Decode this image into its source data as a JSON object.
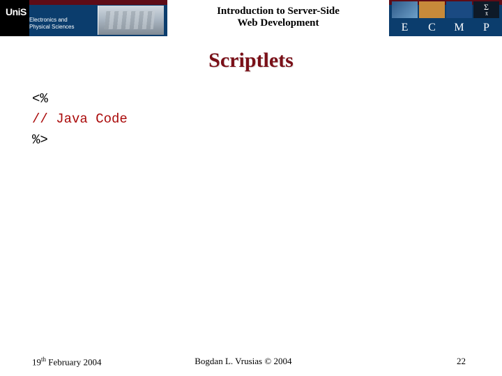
{
  "header": {
    "uni_logo_text": "UniS",
    "dept_line1": "Electronics and",
    "dept_line2": "Physical Sciences",
    "title_line1": "Introduction to Server-Side",
    "title_line2": "Web Development",
    "letters": [
      "E",
      "C",
      "M",
      "P"
    ],
    "sigma": "Σ",
    "sigma_sub": "x̄"
  },
  "slide": {
    "title": "Scriptlets",
    "code": {
      "open": "<%",
      "comment": "// Java Code",
      "close": "%>"
    }
  },
  "footer": {
    "date_day": "19",
    "date_suffix": "th",
    "date_rest": " February 2004",
    "author": "Bogdan L. Vrusias © 2004",
    "page": "22"
  }
}
